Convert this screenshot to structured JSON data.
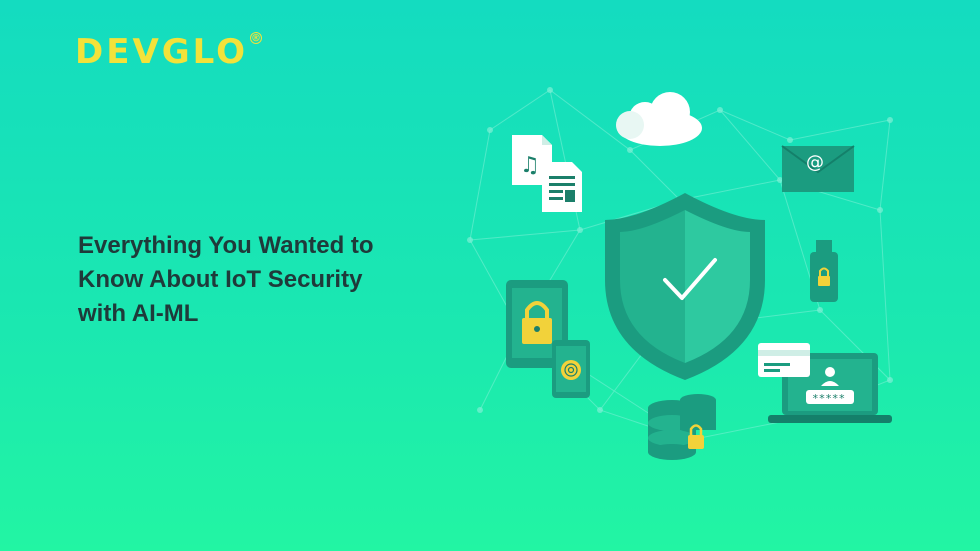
{
  "brand": {
    "logo_text": "DEVGLO",
    "registered_mark": "®",
    "color": "#f2e23a"
  },
  "headline": {
    "lines": [
      "Everything You Wanted to",
      "Know About IoT Security",
      "with AI-ML"
    ],
    "color": "#1f3a3a"
  },
  "illustration": {
    "password_mask": "*****",
    "email_symbol": "@",
    "icons": [
      "cloud-icon",
      "music-file-icon",
      "document-icon",
      "email-icon",
      "shield-check-icon",
      "usb-lock-icon",
      "tablet-lock-icon",
      "phone-fingerprint-icon",
      "database-lock-icon",
      "laptop-login-icon",
      "credit-card-icon"
    ]
  },
  "colors": {
    "background_top": "#14dcc0",
    "background_bottom": "#22f5a3",
    "shield_dark": "#1b9c80",
    "shield_light": "#2ec9a0",
    "lock_yellow": "#f2d23a"
  }
}
